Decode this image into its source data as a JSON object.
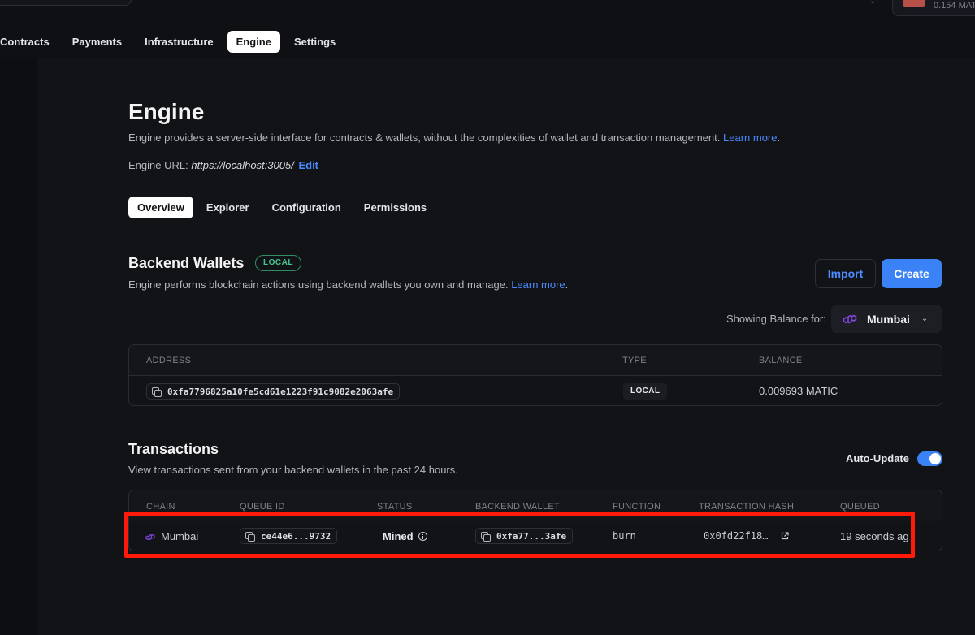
{
  "top_nav": {
    "account_balance": "0.154 MAT",
    "items": [
      {
        "label": "Contracts",
        "active": false
      },
      {
        "label": "Payments",
        "active": false
      },
      {
        "label": "Infrastructure",
        "active": false
      },
      {
        "label": "Engine",
        "active": true
      },
      {
        "label": "Settings",
        "active": false
      }
    ]
  },
  "page": {
    "title": "Engine",
    "description": "Engine provides a server-side interface for contracts & wallets, without the complexities of wallet and transaction management.",
    "learn_more": "Learn more",
    "learn_more_suffix": ".",
    "engine_url_label": "Engine URL:",
    "engine_url": "https://localhost:3005/",
    "edit_label": "Edit"
  },
  "sub_tabs": [
    {
      "label": "Overview",
      "active": true
    },
    {
      "label": "Explorer",
      "active": false
    },
    {
      "label": "Configuration",
      "active": false
    },
    {
      "label": "Permissions",
      "active": false
    }
  ],
  "backend_wallets": {
    "title": "Backend Wallets",
    "badge": "LOCAL",
    "description": "Engine performs blockchain actions using backend wallets you own and manage.",
    "learn_more": "Learn more",
    "learn_more_suffix": ".",
    "import_label": "Import",
    "create_label": "Create",
    "balance_label": "Showing Balance for:",
    "selected_chain": "Mumbai",
    "columns": [
      "ADDRESS",
      "TYPE",
      "BALANCE"
    ],
    "rows": [
      {
        "address": "0xfa7796825a10fe5cd61e1223f91c9082e2063afe",
        "type": "LOCAL",
        "balance": "0.009693 MATIC"
      }
    ]
  },
  "transactions": {
    "title": "Transactions",
    "description": "View transactions sent from your backend wallets in the past 24 hours.",
    "auto_update_label": "Auto-Update",
    "auto_update_on": true,
    "columns": [
      "CHAIN",
      "QUEUE ID",
      "STATUS",
      "BACKEND WALLET",
      "FUNCTION",
      "TRANSACTION HASH",
      "QUEUED"
    ],
    "rows": [
      {
        "chain": "Mumbai",
        "queue_id": "ce44e6...9732",
        "status": "Mined",
        "backend_wallet": "0xfa77...3afe",
        "function": "burn",
        "tx_hash": "0x0fd22f18…",
        "queued": "19 seconds ag"
      }
    ]
  },
  "colors": {
    "accent_blue": "#3b82f6",
    "link_blue": "#4a8bff",
    "local_badge_green": "#48c58c",
    "highlight_red": "#ff1a0a",
    "polygon_purple": "#8247e5"
  }
}
